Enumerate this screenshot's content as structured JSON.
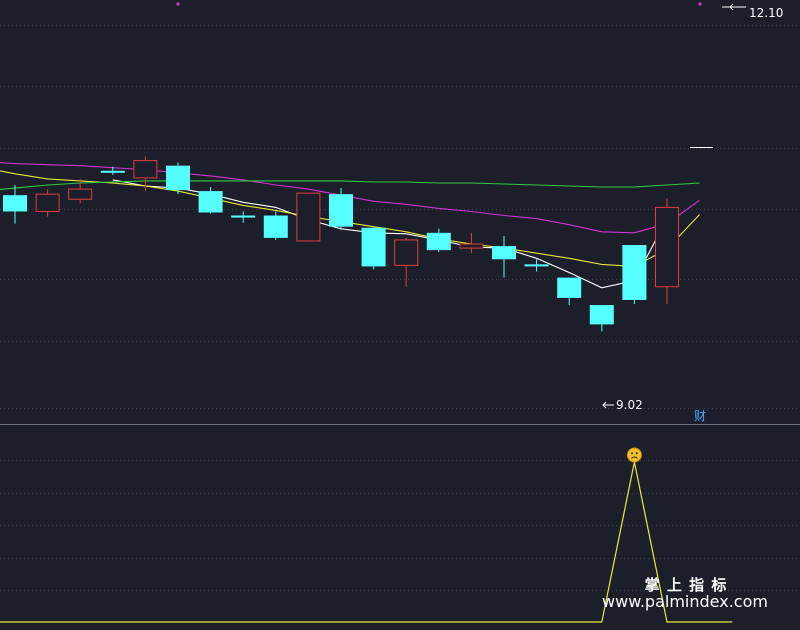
{
  "chart_data": [
    {
      "type": "candlestick",
      "ylim": [
        8.15,
        12.2
      ],
      "annotations": {
        "high_label": "12.10",
        "low_label": "9.02",
        "event_marker": "财"
      },
      "candles": [
        {
          "o": 10.36,
          "h": 10.46,
          "l": 10.08,
          "c": 10.2
        },
        {
          "o": 10.2,
          "h": 10.42,
          "l": 10.15,
          "c": 10.37
        },
        {
          "o": 10.32,
          "h": 10.52,
          "l": 10.28,
          "c": 10.42
        },
        {
          "o": 10.6,
          "h": 10.64,
          "l": 10.56,
          "c": 10.58
        },
        {
          "o": 10.53,
          "h": 10.74,
          "l": 10.4,
          "c": 10.7
        },
        {
          "o": 10.65,
          "h": 10.68,
          "l": 10.37,
          "c": 10.41
        },
        {
          "o": 10.4,
          "h": 10.44,
          "l": 10.18,
          "c": 10.19
        },
        {
          "o": 10.16,
          "h": 10.2,
          "l": 10.09,
          "c": 10.14
        },
        {
          "o": 10.16,
          "h": 10.2,
          "l": 9.92,
          "c": 9.94
        },
        {
          "o": 9.91,
          "h": 10.38,
          "l": 9.91,
          "c": 10.38
        },
        {
          "o": 10.37,
          "h": 10.43,
          "l": 10.02,
          "c": 10.05
        },
        {
          "o": 10.04,
          "h": 10.04,
          "l": 9.63,
          "c": 9.66
        },
        {
          "o": 9.67,
          "h": 9.94,
          "l": 9.46,
          "c": 9.92
        },
        {
          "o": 9.99,
          "h": 10.03,
          "l": 9.8,
          "c": 9.82
        },
        {
          "o": 9.84,
          "h": 9.99,
          "l": 9.79,
          "c": 9.88
        },
        {
          "o": 9.86,
          "h": 9.96,
          "l": 9.55,
          "c": 9.73
        },
        {
          "o": 9.68,
          "h": 9.73,
          "l": 9.61,
          "c": 9.66
        },
        {
          "o": 9.55,
          "h": 9.55,
          "l": 9.28,
          "c": 9.35
        },
        {
          "o": 9.28,
          "h": 9.28,
          "l": 9.02,
          "c": 9.09
        },
        {
          "o": 9.87,
          "h": 9.87,
          "l": 9.29,
          "c": 9.33
        },
        {
          "o": 9.46,
          "h": 10.33,
          "l": 9.29,
          "c": 10.24
        }
      ],
      "moving_averages": [
        {
          "color": "#ffffff",
          "values": [
            null,
            null,
            null,
            null,
            10.51,
            10.45,
            10.43,
            10.37,
            10.29,
            10.24,
            10.12,
            10.03,
            9.99,
            9.98,
            9.92,
            9.85,
            9.84,
            9.74,
            9.6,
            9.45,
            9.52,
            10.13
          ]
        },
        {
          "color": "#e8e83a",
          "values": [
            10.63,
            10.57,
            10.52,
            10.5,
            10.48,
            10.45,
            10.4,
            10.33,
            10.26,
            10.21,
            10.15,
            10.1,
            10.05,
            10.0,
            9.93,
            9.88,
            9.84,
            9.79,
            9.74,
            9.68,
            9.66,
            9.83,
            10.17
          ]
        },
        {
          "color": "#d033d0",
          "values": [
            10.69,
            10.67,
            10.66,
            10.65,
            10.63,
            10.61,
            10.58,
            10.55,
            10.51,
            10.46,
            10.42,
            10.36,
            10.3,
            10.27,
            10.23,
            10.2,
            10.16,
            10.13,
            10.07,
            10.0,
            9.99,
            10.08,
            10.31
          ]
        },
        {
          "color": "#2ecc40",
          "values": [
            10.4,
            10.43,
            10.46,
            10.48,
            10.49,
            10.5,
            10.5,
            10.5,
            10.5,
            10.5,
            10.5,
            10.5,
            10.49,
            10.49,
            10.48,
            10.48,
            10.47,
            10.46,
            10.45,
            10.44,
            10.44,
            10.46,
            10.48
          ]
        }
      ]
    },
    {
      "type": "line",
      "ylim": [
        0,
        1
      ],
      "color": "#e8e83a",
      "values": [
        0,
        0,
        0,
        0,
        0,
        0,
        0,
        0,
        0,
        0,
        0,
        0,
        0,
        0,
        0,
        0,
        0,
        0,
        0,
        0,
        1,
        0,
        0,
        0
      ],
      "signal_icon": "frowning-face-icon"
    }
  ],
  "watermark": {
    "title": "掌 上 指 标",
    "url": "www.palmindex.com"
  },
  "colors": {
    "background": "#1c1f2a",
    "up": "#e23c3c",
    "down": "#55ffff",
    "grid": "#3b4150",
    "separator": "#6b7180"
  }
}
